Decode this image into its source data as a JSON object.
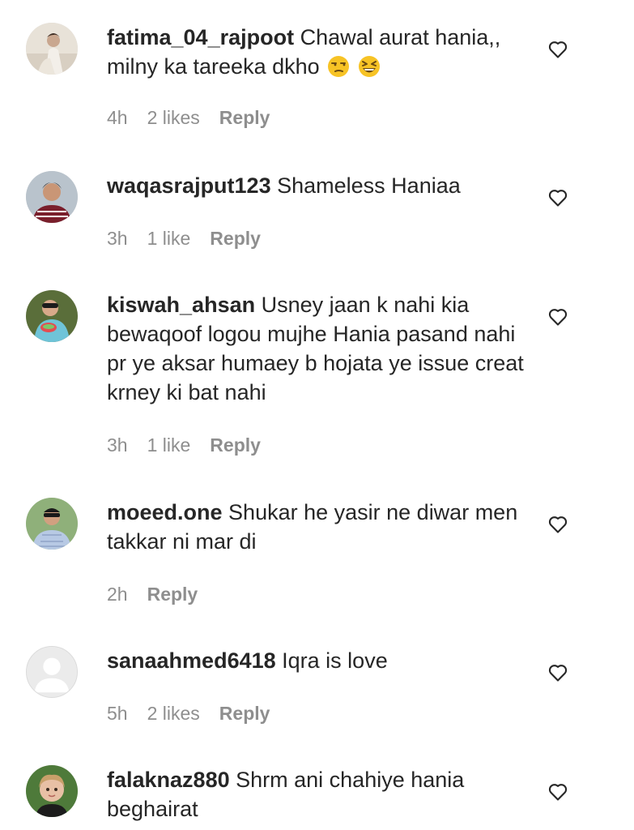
{
  "comments": [
    {
      "username": "fatima_04_rajpoot",
      "text": "Chawal aurat hania,, milny ka tareeka dkho",
      "emojis": [
        "unamused-face-emoji",
        "grinning-squinting-face-emoji"
      ],
      "time": "4h",
      "likes": "2 likes",
      "reply": "Reply"
    },
    {
      "username": "waqasrajput123",
      "text": "Shameless Haniaa",
      "time": "3h",
      "likes": "1 like",
      "reply": "Reply"
    },
    {
      "username": "kiswah_ahsan",
      "text": "Usney jaan k nahi kia bewaqoof logou mujhe Hania pasand nahi pr ye aksar humaey b hojata ye issue creat krney ki bat nahi",
      "time": "3h",
      "likes": "1 like",
      "reply": "Reply"
    },
    {
      "username": "moeed.one",
      "text": "Shukar he yasir ne diwar men takkar ni mar di",
      "time": "2h",
      "reply": "Reply"
    },
    {
      "username": "sanaahmed6418",
      "text": "Iqra is love",
      "time": "5h",
      "likes": "2 likes",
      "reply": "Reply"
    },
    {
      "username": "falaknaz880",
      "text": "Shrm ani chahiye hania beghairat"
    }
  ],
  "colors": {
    "text": "#262626",
    "secondary": "#8e8e8e",
    "background": "#ffffff"
  },
  "icons": {
    "like": "heart-outline-icon",
    "default_avatar": "default-avatar-icon"
  }
}
